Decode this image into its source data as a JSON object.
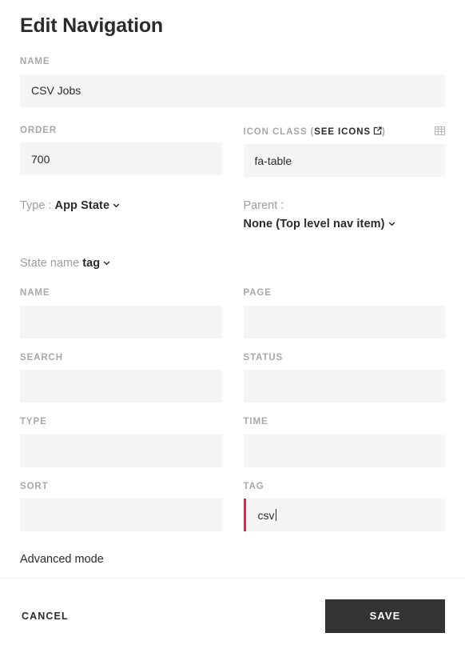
{
  "dialog": {
    "title": "Edit Navigation"
  },
  "name_field": {
    "label": "NAME",
    "value": "CSV Jobs",
    "placeholder": ""
  },
  "order_field": {
    "label": "ORDER",
    "value": "700",
    "placeholder": ""
  },
  "icon_class_field": {
    "label_prefix": "ICON CLASS (",
    "label_link": "SEE ICONS",
    "label_suffix": ")",
    "link_icon": "external-link-icon",
    "preview_icon": "table-grid-icon",
    "value": "fa-table",
    "placeholder": ""
  },
  "type_select": {
    "label": "Type :",
    "value": "App State",
    "chevron": "chevron-down-icon"
  },
  "parent_select": {
    "label": "Parent :",
    "value": "None (Top level nav item)",
    "chevron": "chevron-down-icon"
  },
  "state_name_select": {
    "label": "State name",
    "value": "tag",
    "chevron": "chevron-down-icon"
  },
  "params": [
    [
      {
        "label": "NAME",
        "value": "",
        "placeholder": "",
        "focused": false
      },
      {
        "label": "PAGE",
        "value": "",
        "placeholder": "",
        "focused": false
      }
    ],
    [
      {
        "label": "SEARCH",
        "value": "",
        "placeholder": "",
        "focused": false
      },
      {
        "label": "STATUS",
        "value": "",
        "placeholder": "",
        "focused": false
      }
    ],
    [
      {
        "label": "TYPE",
        "value": "",
        "placeholder": "",
        "focused": false
      },
      {
        "label": "TIME",
        "value": "",
        "placeholder": "",
        "focused": false
      }
    ],
    [
      {
        "label": "SORT",
        "value": "",
        "placeholder": "",
        "focused": false
      },
      {
        "label": "TAG",
        "value": "csv",
        "placeholder": "",
        "focused": true
      }
    ]
  ],
  "advanced_mode": {
    "label": "Advanced mode"
  },
  "footer": {
    "cancel_label": "CANCEL",
    "save_label": "SAVE"
  },
  "colors": {
    "accent_focus": "#ec1c4b",
    "save_button_bg": "#333333",
    "input_bg": "#f5f5f5",
    "label_grey": "#a8a8a8",
    "text_dark": "#2b2b2b"
  }
}
